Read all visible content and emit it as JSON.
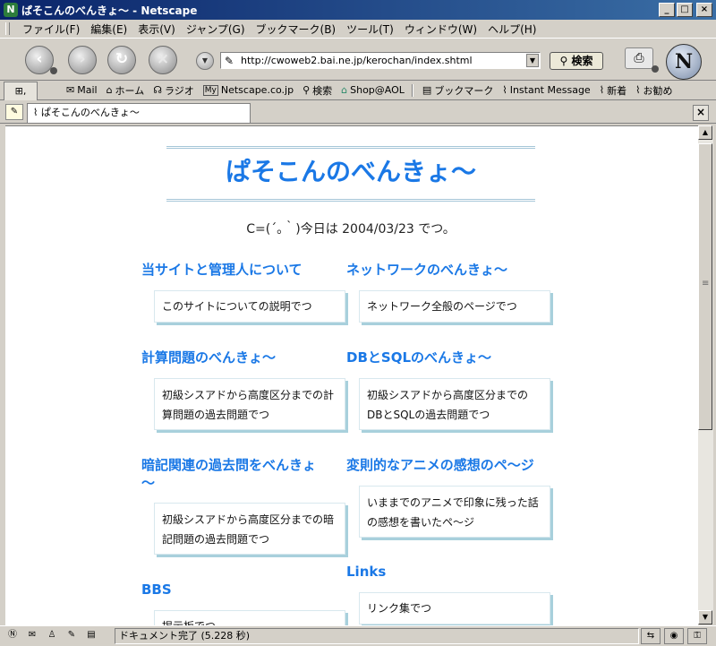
{
  "window": {
    "title": "ぱそこんのべんきょ～ - Netscape",
    "app_icon": "N"
  },
  "menu": [
    "ファイル(F)",
    "編集(E)",
    "表示(V)",
    "ジャンプ(G)",
    "ブックマーク(B)",
    "ツール(T)",
    "ウィンドウ(W)",
    "ヘルプ(H)"
  ],
  "nav": {
    "url": "http://cwoweb2.bai.ne.jp/kerochan/index.shtml",
    "search_label": "検索"
  },
  "personal_toolbar": {
    "items": [
      {
        "label": "Mail",
        "icon": "mail-icon",
        "glyph": "✉"
      },
      {
        "label": "ホーム",
        "icon": "home-icon",
        "glyph": "⌂"
      },
      {
        "label": "ラジオ",
        "icon": "radio-icon",
        "glyph": "☊"
      },
      {
        "label": "Netscape.co.jp",
        "icon": "my-icon",
        "glyph": "My"
      },
      {
        "label": "検索",
        "icon": "search-icon",
        "glyph": "⚲"
      },
      {
        "label": "Shop@AOL",
        "icon": "shop-icon",
        "glyph": "⌂"
      },
      {
        "label": "ブックマーク",
        "icon": "bookmark-icon",
        "glyph": "▤"
      },
      {
        "label": "Instant Message",
        "icon": "link-icon",
        "glyph": "⌇"
      },
      {
        "label": "新着",
        "icon": "link-icon",
        "glyph": "⌇"
      },
      {
        "label": "お勧め",
        "icon": "link-icon",
        "glyph": "⌇"
      }
    ]
  },
  "tab": {
    "label": "ぱそこんのべんきょ～"
  },
  "page": {
    "title": "ぱそこんのべんきょ～",
    "date_line": "C=(´｡｀)今日は 2004/03/23 でつ。",
    "sections": [
      {
        "title": "当サイトと管理人について",
        "desc": "このサイトについての説明でつ"
      },
      {
        "title": "ネットワークのべんきょ～",
        "desc": "ネットワーク全般のページでつ"
      },
      {
        "title": "計算問題のべんきょ～",
        "desc_lines": [
          "初級シスアドから高度区分までの計",
          "算問題の過去問題でつ"
        ]
      },
      {
        "title": "DBとSQLのべんきょ～",
        "desc_lines": [
          "初級シスアドから高度区分までの",
          "DBとSQLの過去問題でつ"
        ]
      },
      {
        "title_lines": [
          "暗記関連の過去問をべんきょ",
          "～"
        ],
        "desc_lines": [
          "初級シスアドから高度区分までの暗",
          "記問題の過去問題でつ"
        ]
      },
      {
        "title": "変則的なアニメの感想のペ～ジ",
        "desc_lines": [
          "いままでのアニメで印象に残った話",
          "の感想を書いたペ～ジ"
        ]
      },
      {
        "title": "Links",
        "desc": "リンク集でつ"
      },
      {
        "title": "BBS",
        "desc": "掲示板でつ"
      }
    ]
  },
  "status": {
    "text": "ドキュメント完了 (5.228 秒)"
  },
  "colors": {
    "link": "#1a78e6",
    "box_shadow": "#a8d0dc",
    "title_bar": "#0a246a"
  }
}
